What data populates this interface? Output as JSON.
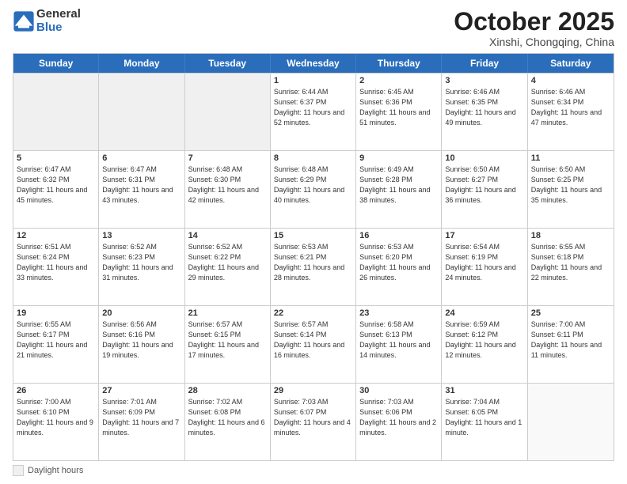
{
  "logo": {
    "general": "General",
    "blue": "Blue"
  },
  "title": "October 2025",
  "subtitle": "Xinshi, Chongqing, China",
  "days_of_week": [
    "Sunday",
    "Monday",
    "Tuesday",
    "Wednesday",
    "Thursday",
    "Friday",
    "Saturday"
  ],
  "footer_label": "Daylight hours",
  "weeks": [
    [
      {
        "day": "",
        "empty": true
      },
      {
        "day": "",
        "empty": true
      },
      {
        "day": "",
        "empty": true
      },
      {
        "day": "1",
        "sunrise": "6:44 AM",
        "sunset": "6:37 PM",
        "daylight": "11 hours and 52 minutes."
      },
      {
        "day": "2",
        "sunrise": "6:45 AM",
        "sunset": "6:36 PM",
        "daylight": "11 hours and 51 minutes."
      },
      {
        "day": "3",
        "sunrise": "6:46 AM",
        "sunset": "6:35 PM",
        "daylight": "11 hours and 49 minutes."
      },
      {
        "day": "4",
        "sunrise": "6:46 AM",
        "sunset": "6:34 PM",
        "daylight": "11 hours and 47 minutes."
      }
    ],
    [
      {
        "day": "5",
        "sunrise": "6:47 AM",
        "sunset": "6:32 PM",
        "daylight": "11 hours and 45 minutes."
      },
      {
        "day": "6",
        "sunrise": "6:47 AM",
        "sunset": "6:31 PM",
        "daylight": "11 hours and 43 minutes."
      },
      {
        "day": "7",
        "sunrise": "6:48 AM",
        "sunset": "6:30 PM",
        "daylight": "11 hours and 42 minutes."
      },
      {
        "day": "8",
        "sunrise": "6:48 AM",
        "sunset": "6:29 PM",
        "daylight": "11 hours and 40 minutes."
      },
      {
        "day": "9",
        "sunrise": "6:49 AM",
        "sunset": "6:28 PM",
        "daylight": "11 hours and 38 minutes."
      },
      {
        "day": "10",
        "sunrise": "6:50 AM",
        "sunset": "6:27 PM",
        "daylight": "11 hours and 36 minutes."
      },
      {
        "day": "11",
        "sunrise": "6:50 AM",
        "sunset": "6:25 PM",
        "daylight": "11 hours and 35 minutes."
      }
    ],
    [
      {
        "day": "12",
        "sunrise": "6:51 AM",
        "sunset": "6:24 PM",
        "daylight": "11 hours and 33 minutes."
      },
      {
        "day": "13",
        "sunrise": "6:52 AM",
        "sunset": "6:23 PM",
        "daylight": "11 hours and 31 minutes."
      },
      {
        "day": "14",
        "sunrise": "6:52 AM",
        "sunset": "6:22 PM",
        "daylight": "11 hours and 29 minutes."
      },
      {
        "day": "15",
        "sunrise": "6:53 AM",
        "sunset": "6:21 PM",
        "daylight": "11 hours and 28 minutes."
      },
      {
        "day": "16",
        "sunrise": "6:53 AM",
        "sunset": "6:20 PM",
        "daylight": "11 hours and 26 minutes."
      },
      {
        "day": "17",
        "sunrise": "6:54 AM",
        "sunset": "6:19 PM",
        "daylight": "11 hours and 24 minutes."
      },
      {
        "day": "18",
        "sunrise": "6:55 AM",
        "sunset": "6:18 PM",
        "daylight": "11 hours and 22 minutes."
      }
    ],
    [
      {
        "day": "19",
        "sunrise": "6:55 AM",
        "sunset": "6:17 PM",
        "daylight": "11 hours and 21 minutes."
      },
      {
        "day": "20",
        "sunrise": "6:56 AM",
        "sunset": "6:16 PM",
        "daylight": "11 hours and 19 minutes."
      },
      {
        "day": "21",
        "sunrise": "6:57 AM",
        "sunset": "6:15 PM",
        "daylight": "11 hours and 17 minutes."
      },
      {
        "day": "22",
        "sunrise": "6:57 AM",
        "sunset": "6:14 PM",
        "daylight": "11 hours and 16 minutes."
      },
      {
        "day": "23",
        "sunrise": "6:58 AM",
        "sunset": "6:13 PM",
        "daylight": "11 hours and 14 minutes."
      },
      {
        "day": "24",
        "sunrise": "6:59 AM",
        "sunset": "6:12 PM",
        "daylight": "11 hours and 12 minutes."
      },
      {
        "day": "25",
        "sunrise": "7:00 AM",
        "sunset": "6:11 PM",
        "daylight": "11 hours and 11 minutes."
      }
    ],
    [
      {
        "day": "26",
        "sunrise": "7:00 AM",
        "sunset": "6:10 PM",
        "daylight": "11 hours and 9 minutes."
      },
      {
        "day": "27",
        "sunrise": "7:01 AM",
        "sunset": "6:09 PM",
        "daylight": "11 hours and 7 minutes."
      },
      {
        "day": "28",
        "sunrise": "7:02 AM",
        "sunset": "6:08 PM",
        "daylight": "11 hours and 6 minutes."
      },
      {
        "day": "29",
        "sunrise": "7:03 AM",
        "sunset": "6:07 PM",
        "daylight": "11 hours and 4 minutes."
      },
      {
        "day": "30",
        "sunrise": "7:03 AM",
        "sunset": "6:06 PM",
        "daylight": "11 hours and 2 minutes."
      },
      {
        "day": "31",
        "sunrise": "7:04 AM",
        "sunset": "6:05 PM",
        "daylight": "11 hours and 1 minute."
      },
      {
        "day": "",
        "empty": true
      }
    ]
  ]
}
